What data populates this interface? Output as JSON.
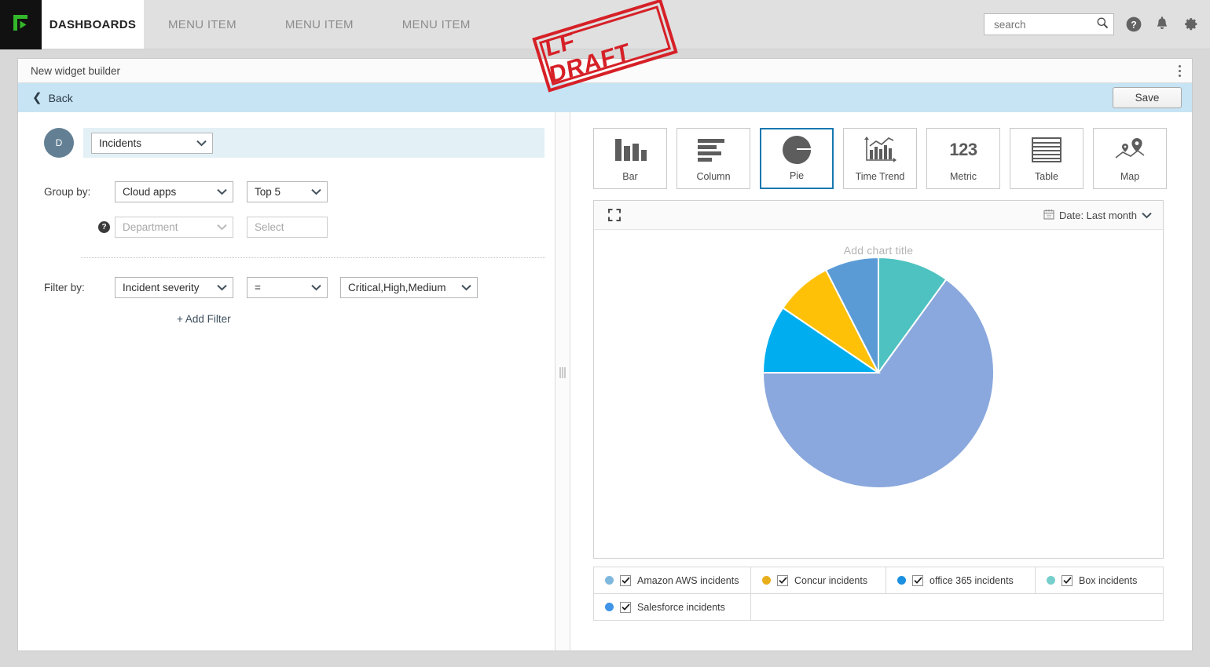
{
  "topnav": {
    "logo_icon": "brand-logo-icon",
    "active_tab": "DASHBOARDS",
    "menu_items": [
      "MENU ITEM",
      "MENU ITEM",
      "MENU ITEM"
    ],
    "search": {
      "value": "",
      "placeholder": "search",
      "icon": "search-icon"
    },
    "icons": [
      "help-circle-icon",
      "bell-icon",
      "gear-icon"
    ]
  },
  "stamp": {
    "text": "LF DRAFT",
    "color": "#d62027"
  },
  "builder": {
    "title": "New widget builder",
    "kebab_icon": "more-vertical-icon",
    "back_label": "Back",
    "back_icon": "chevron-left-icon",
    "save_label": "Save",
    "backbar_color": "#c7e4f5"
  },
  "config": {
    "avatar_letter": "D",
    "source": {
      "value": "Incidents",
      "icon": "chevron-down-icon"
    },
    "group_by": {
      "label": "Group by:",
      "field": "Cloud apps",
      "limit": "Top 5"
    },
    "dimension": {
      "help_icon": "help-badge-icon",
      "field_placeholder": "Department",
      "value_placeholder": "Select"
    },
    "filter": {
      "label": "Filter by:",
      "field": "Incident severity",
      "operator": "=",
      "value": "Critical,High,Medium",
      "add_label": "+ Add Filter"
    }
  },
  "chart_types": [
    {
      "label": "Bar",
      "icon": "bar-chart-icon",
      "selected": false
    },
    {
      "label": "Column",
      "icon": "column-chart-icon",
      "selected": false
    },
    {
      "label": "Pie",
      "icon": "pie-chart-icon",
      "selected": true
    },
    {
      "label": "Time Trend",
      "icon": "time-trend-icon",
      "selected": false
    },
    {
      "label": "Metric",
      "icon": "metric-icon",
      "metric_sample": "123",
      "selected": false
    },
    {
      "label": "Table",
      "icon": "table-icon",
      "selected": false
    },
    {
      "label": "Map",
      "icon": "map-pin-icon",
      "selected": false
    }
  ],
  "preview": {
    "expand_icon": "expand-icon",
    "calendar_icon": "calendar-icon",
    "date_label": "Date: Last month",
    "date_chevron_icon": "chevron-down-icon",
    "chart_title_placeholder": "Add chart title",
    "selected_accent": "#1878b0"
  },
  "legend": [
    {
      "label": "Amazon AWS incidents",
      "color": "#7fb8dd",
      "checked": true
    },
    {
      "label": "Concur incidents",
      "color": "#e8ae1c",
      "checked": true
    },
    {
      "label": "office 365 incidents",
      "color": "#1b8fe0",
      "checked": true
    },
    {
      "label": "Box incidents",
      "color": "#76cfcc",
      "checked": true
    },
    {
      "label": "Salesforce incidents",
      "color": "#3f93e8",
      "checked": true
    }
  ],
  "chart_data": {
    "type": "pie",
    "title": "Add chart title",
    "labels": [
      "Box incidents",
      "Salesforce incidents",
      "office 365 incidents",
      "Concur incidents",
      "Amazon AWS incidents"
    ],
    "values": [
      10,
      65,
      9.5,
      8,
      7.5
    ],
    "colors": [
      "#4ec2c0",
      "#8aa8dd",
      "#00aeef",
      "#ffc107",
      "#5b9bd5"
    ],
    "unit": "%",
    "start_angle": 0,
    "direction": "clockwise",
    "slice_border": "#ffffff",
    "legend_position": "bottom",
    "grid": false
  }
}
